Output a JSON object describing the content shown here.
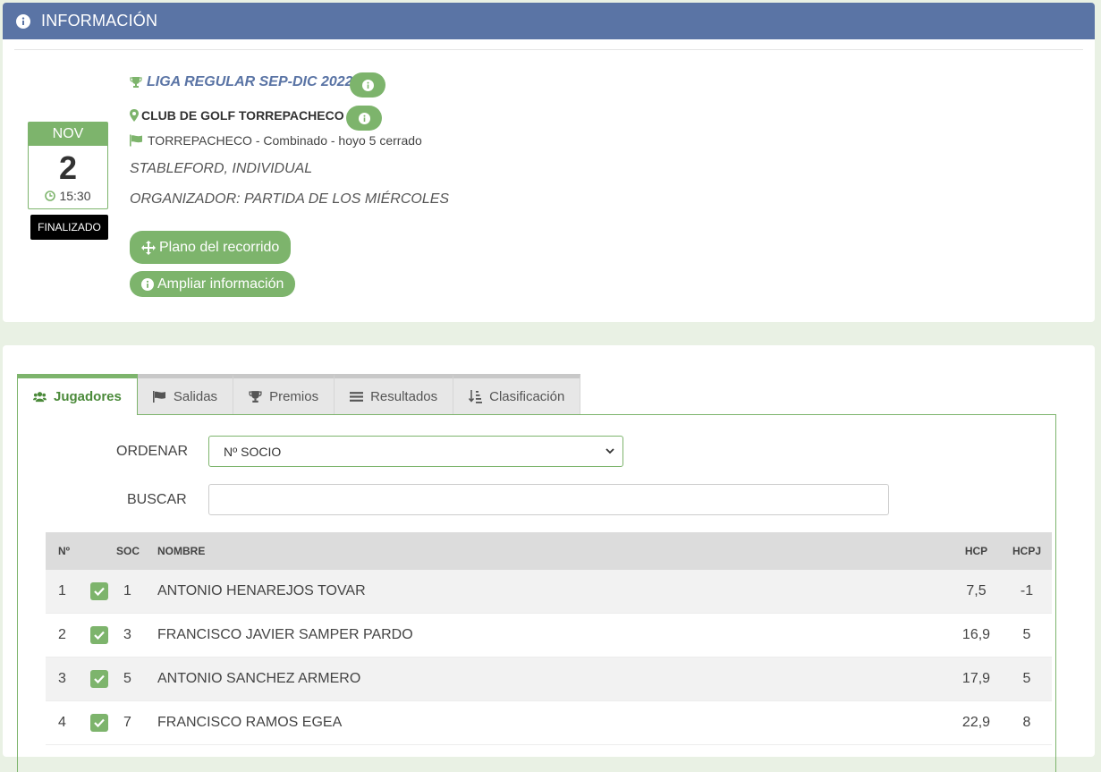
{
  "header": {
    "title": "INFORMACIÓN",
    "icon": "info-circle-icon"
  },
  "event": {
    "month": "NOV",
    "day": "2",
    "time": "15:30",
    "status": "FINALIZADO",
    "league": "LIGA REGULAR SEP-DIC 2022",
    "club": "CLUB DE GOLF TORREPACHECO",
    "course": "TORREPACHECO - Combinado - hoyo 5 cerrado",
    "format": "STABLEFORD, INDIVIDUAL",
    "organizer": "ORGANIZADOR: PARTIDA DE LOS MIÉRCOLES"
  },
  "buttons": {
    "course_map": "Plano del recorrido",
    "more_info": "Ampliar información"
  },
  "tabs": [
    {
      "label": "Jugadores",
      "icon": "users-icon",
      "active": true
    },
    {
      "label": "Salidas",
      "icon": "flag-icon",
      "active": false
    },
    {
      "label": "Premios",
      "icon": "trophy-icon",
      "active": false
    },
    {
      "label": "Resultados",
      "icon": "list-icon",
      "active": false
    },
    {
      "label": "Clasificación",
      "icon": "sort-icon",
      "active": false
    }
  ],
  "filters": {
    "sort_label": "ORDENAR",
    "sort_value": "Nº SOCIO",
    "search_label": "BUSCAR",
    "search_value": ""
  },
  "table": {
    "headers": {
      "no": "Nº",
      "soc": "SOC",
      "name": "NOMBRE",
      "hcp": "HCP",
      "hcpj": "HCPJ"
    },
    "rows": [
      {
        "no": "1",
        "soc": "1",
        "name": "ANTONIO HENAREJOS TOVAR",
        "hcp": "7,5",
        "hcpj": "-1",
        "checked": true
      },
      {
        "no": "2",
        "soc": "3",
        "name": "FRANCISCO JAVIER SAMPER PARDO",
        "hcp": "16,9",
        "hcpj": "5",
        "checked": true
      },
      {
        "no": "3",
        "soc": "5",
        "name": "ANTONIO SANCHEZ ARMERO",
        "hcp": "17,9",
        "hcpj": "5",
        "checked": true
      },
      {
        "no": "4",
        "soc": "7",
        "name": "FRANCISCO RAMOS EGEA",
        "hcp": "22,9",
        "hcpj": "8",
        "checked": true
      }
    ]
  },
  "colors": {
    "accent_green": "#7db46c",
    "header_blue": "#5a74a5"
  }
}
